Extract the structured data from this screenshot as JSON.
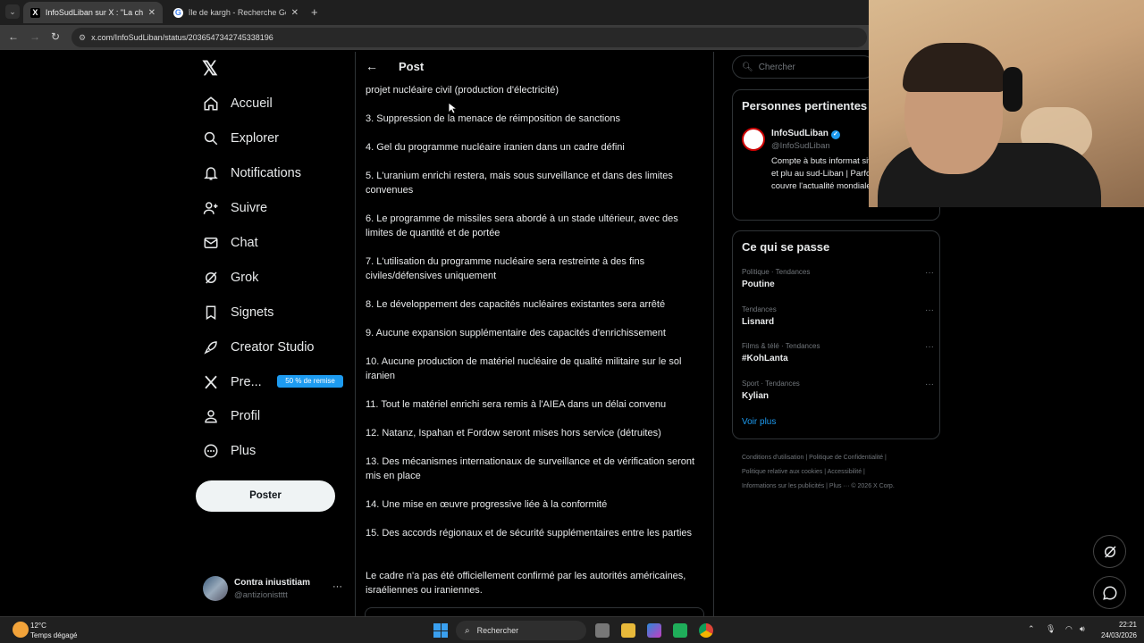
{
  "browser": {
    "tabs": [
      {
        "label": "InfoSudLiban sur X : \"La chaîne",
        "favicon": "x-logo-icon",
        "active": true
      },
      {
        "label": "île de kargh - Recherche Google",
        "favicon": "google-icon",
        "active": false
      }
    ],
    "new_tab": "+",
    "url": "x.com/InfoSudLiban/status/2036547342745338196"
  },
  "sidebar": {
    "logo": "𝕏",
    "items": [
      {
        "label": "Accueil",
        "icon": "home-icon"
      },
      {
        "label": "Explorer",
        "icon": "search-icon"
      },
      {
        "label": "Notifications",
        "icon": "bell-icon"
      },
      {
        "label": "Suivre",
        "icon": "follow-icon"
      },
      {
        "label": "Chat",
        "icon": "mail-icon"
      },
      {
        "label": "Grok",
        "icon": "grok-icon"
      },
      {
        "label": "Signets",
        "icon": "bookmark-icon"
      },
      {
        "label": "Creator Studio",
        "icon": "rocket-icon"
      },
      {
        "label": "Pre...",
        "icon": "x-premium-icon"
      },
      {
        "label": "Profil",
        "icon": "person-icon"
      },
      {
        "label": "Plus",
        "icon": "more-circle-icon"
      }
    ],
    "premium_badge": "50 % de remise",
    "post_button": "Poster",
    "account": {
      "name": "Contra iniustitiam",
      "handle": "@antizionistttt",
      "more": "···"
    }
  },
  "main": {
    "header_title": "Post",
    "paragraphs": [
      "projet nucléaire civil (production d'électricité)",
      "3. Suppression de la menace de réimposition de sanctions",
      "4. Gel du programme nucléaire iranien dans un cadre défini",
      "5. L'uranium enrichi restera, mais sous surveillance et dans des limites convenues",
      "6. Le programme de missiles sera abordé à un stade ultérieur, avec des limites de quantité et de portée",
      "7. L'utilisation du programme nucléaire sera restreinte à des fins civiles/défensives uniquement",
      "8. Le développement des capacités nucléaires existantes sera arrêté",
      "9. Aucune expansion supplémentaire des capacités d'enrichissement",
      "10. Aucune production de matériel nucléaire de qualité militaire sur le sol iranien",
      "11. Tout le matériel enrichi sera remis à l'AIEA dans un délai convenu",
      "12. Natanz, Ispahan et Fordow seront mises hors service (détruites)",
      "13. Des mécanismes internationaux de surveillance et de vérification seront mis en place",
      "14. Une mise en œuvre progressive liée à la conformité",
      "15. Des accords régionaux et de sécurité supplémentaires entre les parties",
      "Le cadre n'a pas été officiellement confirmé par les autorités américaines, israéliennes ou iraniennes."
    ]
  },
  "right": {
    "search_placeholder": "Chercher",
    "relevant": {
      "title": "Personnes pertinentes",
      "name": "InfoSudLiban",
      "handle": "@InfoSudLiban",
      "bio": "Compte à buts informat situation au Liban et plu au sud-Liban | Parfois, je avis et couvre l'actualité mondiale."
    },
    "trends": {
      "title": "Ce qui se passe",
      "items": [
        {
          "category": "Politique · Tendances",
          "name": "Poutine"
        },
        {
          "category": "Tendances",
          "name": "Lisnard"
        },
        {
          "category": "Films & télé · Tendances",
          "name": "#KohLanta"
        },
        {
          "category": "Sport · Tendances",
          "name": "Kylian"
        }
      ],
      "see_more": "Voir plus"
    },
    "footer": [
      "Conditions d'utilisation  |  Politique de Confidentialité  |",
      "Politique relative aux cookies  |  Accessibilité  |",
      "Informations sur les publicités  |  Plus ···  © 2026 X Corp."
    ]
  },
  "taskbar": {
    "temperature": "12°C",
    "weather": "Temps dégagé",
    "search": "Rechercher",
    "time": "22:21",
    "date": "24/03/2026"
  },
  "colors": {
    "accent": "#1d9bf0",
    "background": "#000000",
    "text": "#e7e9ea",
    "muted": "#71767b"
  }
}
